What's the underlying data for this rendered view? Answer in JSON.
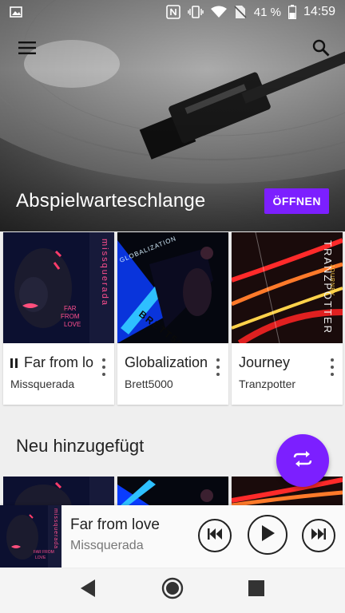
{
  "status_bar": {
    "battery_percent": "41 %",
    "time": "14:59",
    "icons": [
      "image-icon",
      "nfc-icon",
      "vibrate-icon",
      "wifi-icon",
      "no-sim-icon",
      "battery-icon"
    ]
  },
  "app_bar": {
    "menu_icon": "menu-icon",
    "search_icon": "search-icon"
  },
  "queue": {
    "title": "Abspielwarteschlange",
    "open_label": "ÖFFNEN",
    "items": [
      {
        "title": "Far from love",
        "artist": "Missquerada",
        "playing": true,
        "cover_text_vertical": "missquerada",
        "cover_text": "FAR FROM LOVE"
      },
      {
        "title": "Globalization",
        "artist": "Brett5000",
        "playing": false,
        "cover_text": "GLOBALIZATION",
        "cover_text2": "BRETT5000"
      },
      {
        "title": "Journey",
        "artist": "Tranzpotter",
        "playing": false,
        "cover_text": "TRANZPOTTER",
        "cover_text2": "JOURNEY"
      }
    ]
  },
  "recent": {
    "title": "Neu hinzugefügt"
  },
  "now_playing": {
    "title": "Far from love",
    "artist": "Missquerada"
  },
  "colors": {
    "accent": "#7c1fff",
    "background": "#efefef"
  }
}
